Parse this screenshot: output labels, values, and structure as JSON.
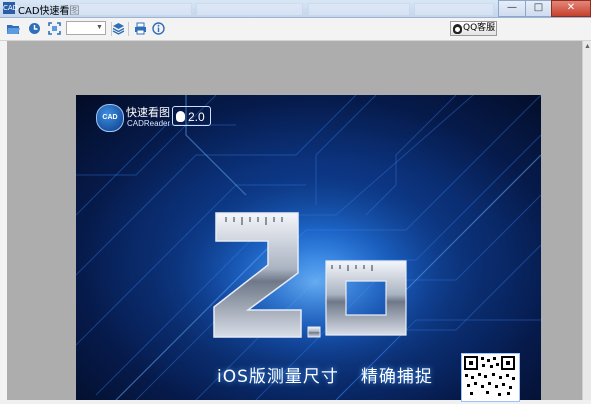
{
  "window": {
    "title": "CAD快速看图",
    "app_icon": "CAD"
  },
  "toolbar": {
    "zoom_value": "",
    "qq_label": "QQ客服",
    "icons": [
      "open-folder-icon",
      "history-icon",
      "fit-screen-icon",
      "zoom-select",
      "layers-icon",
      "print-icon",
      "info-icon"
    ]
  },
  "poster": {
    "logo_badge": "CAD",
    "logo_title": "快速看图",
    "logo_subtitle": "CADReader",
    "version_badge": "2.0",
    "big_number": "2.0",
    "tagline_left": "iOS版测量尺寸",
    "tagline_right": "精确捕捉"
  },
  "colors": {
    "poster_bg": "#0d3a8c",
    "glow": "#4fa0ff",
    "canvas_bg": "#adadad",
    "close_red": "#c6412d"
  }
}
